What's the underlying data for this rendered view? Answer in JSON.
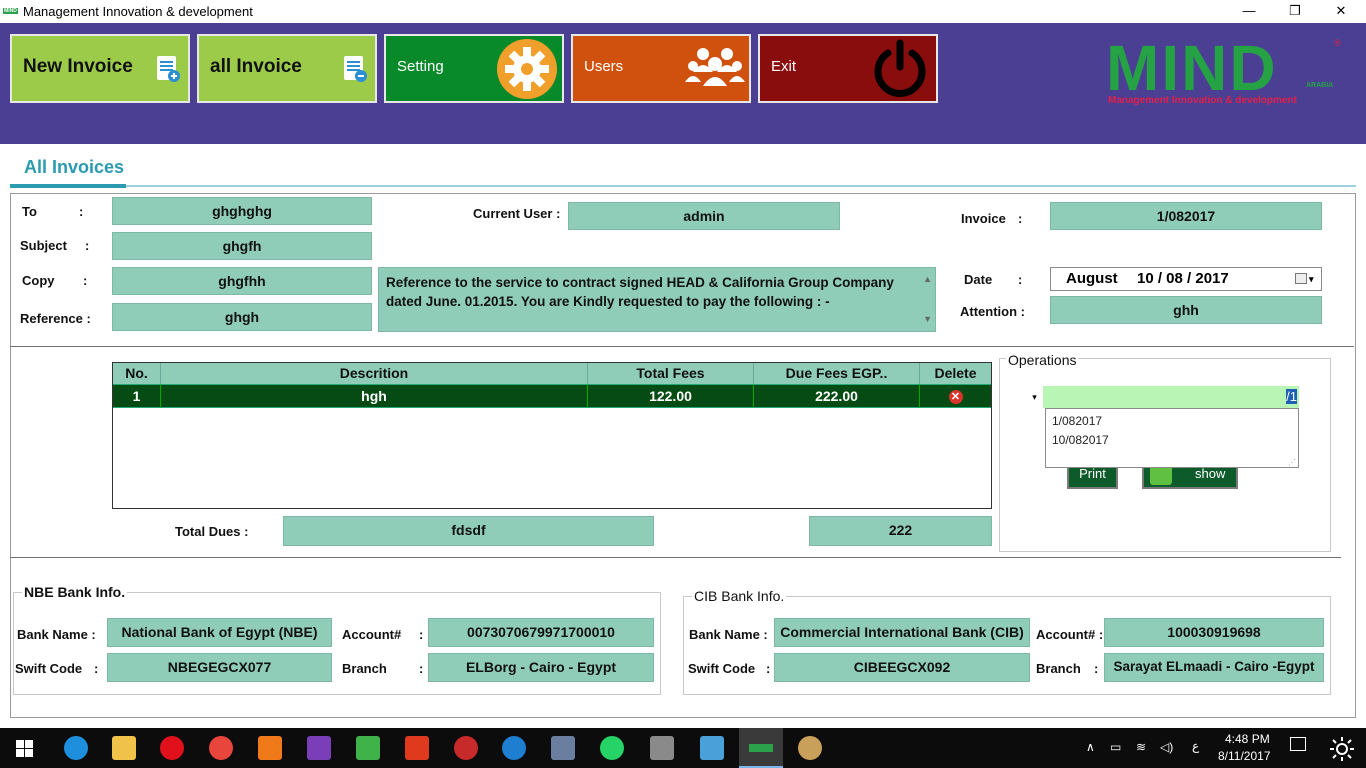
{
  "window": {
    "title": "Management Innovation & development",
    "app_icon_text": "MIND"
  },
  "window_controls": {
    "minimize": "—",
    "restore": "❐",
    "close": "✕"
  },
  "toolbar": {
    "new_invoice": "New Invoice",
    "all_invoice": "all Invoice",
    "setting": "Setting",
    "users": "Users",
    "exit": "Exit"
  },
  "logo": {
    "word": "MIND",
    "tagline": "Management Innovation & development",
    "subword": "ARABIA",
    "reg": "®"
  },
  "tab": {
    "title": "All Invoices"
  },
  "form": {
    "to_label": "To",
    "to_colon": ":",
    "to_value": "ghghghg",
    "subject_label": "Subject",
    "subject_colon": ":",
    "subject_value": "ghgfh",
    "copy_label": "Copy",
    "copy_colon": ":",
    "copy_value": "ghgfhh",
    "reference_label": "Reference :",
    "reference_value": "ghgh",
    "current_user_label": "Current User :",
    "current_user_value": "admin",
    "invoice_label": "Invoice",
    "invoice_colon": ":",
    "invoice_value": "1/082017",
    "date_label": "Date",
    "date_colon": ":",
    "date_month": "August",
    "date_value": "10 / 08 / 2017",
    "attention_label": "Attention :",
    "attention_value": "ghh",
    "note": "Reference to the service to contract signed HEAD & California Group Company dated June. 01.2015. You are Kindly requested to pay the following : -"
  },
  "grid": {
    "columns": [
      "No.",
      "Descrition",
      "Total Fees",
      "Due Fees EGP..",
      "Delete"
    ],
    "rows": [
      {
        "no": "1",
        "desc": "hgh",
        "total": "122.00",
        "due": "222.00",
        "delete": "✕"
      }
    ]
  },
  "totals": {
    "label": "Total Dues :",
    "words": "fdsdf",
    "amount": "222"
  },
  "operations": {
    "title": "Operations",
    "combo_value": "/1",
    "options": [
      "1/082017",
      "10/082017"
    ],
    "print": "Print",
    "show": "show"
  },
  "nbe": {
    "title": "NBE Bank Info.",
    "bank_name_label": "Bank Name :",
    "bank_name": "National Bank of Egypt (NBE)",
    "account_label": "Account#",
    "account_colon": ":",
    "account": "0073070679971700010",
    "swift_label": "Swift Code",
    "swift_colon": ":",
    "swift": "NBEGEGCX077",
    "branch_label": "Branch",
    "branch_colon": ":",
    "branch": "ELBorg - Cairo - Egypt"
  },
  "cib": {
    "title": "CIB Bank Info.",
    "bank_name_label": "Bank Name :",
    "bank_name": "Commercial International Bank (CIB)",
    "account_label": "Account# :",
    "account": "100030919698",
    "swift_label": "Swift Code",
    "swift_colon": ":",
    "swift": "CIBEEGCX092",
    "branch_label": "Branch",
    "branch_colon": ":",
    "branch": "Sarayat ELmaadi - Cairo -Egypt"
  },
  "taskbar": {
    "time": "4:48 PM",
    "date": "8/11/2017",
    "lang": "ع"
  },
  "colors": {
    "header": "#4a3f93",
    "field": "#8fcdb9",
    "grid_row": "#064a14",
    "accent": "#2a9bb0"
  }
}
